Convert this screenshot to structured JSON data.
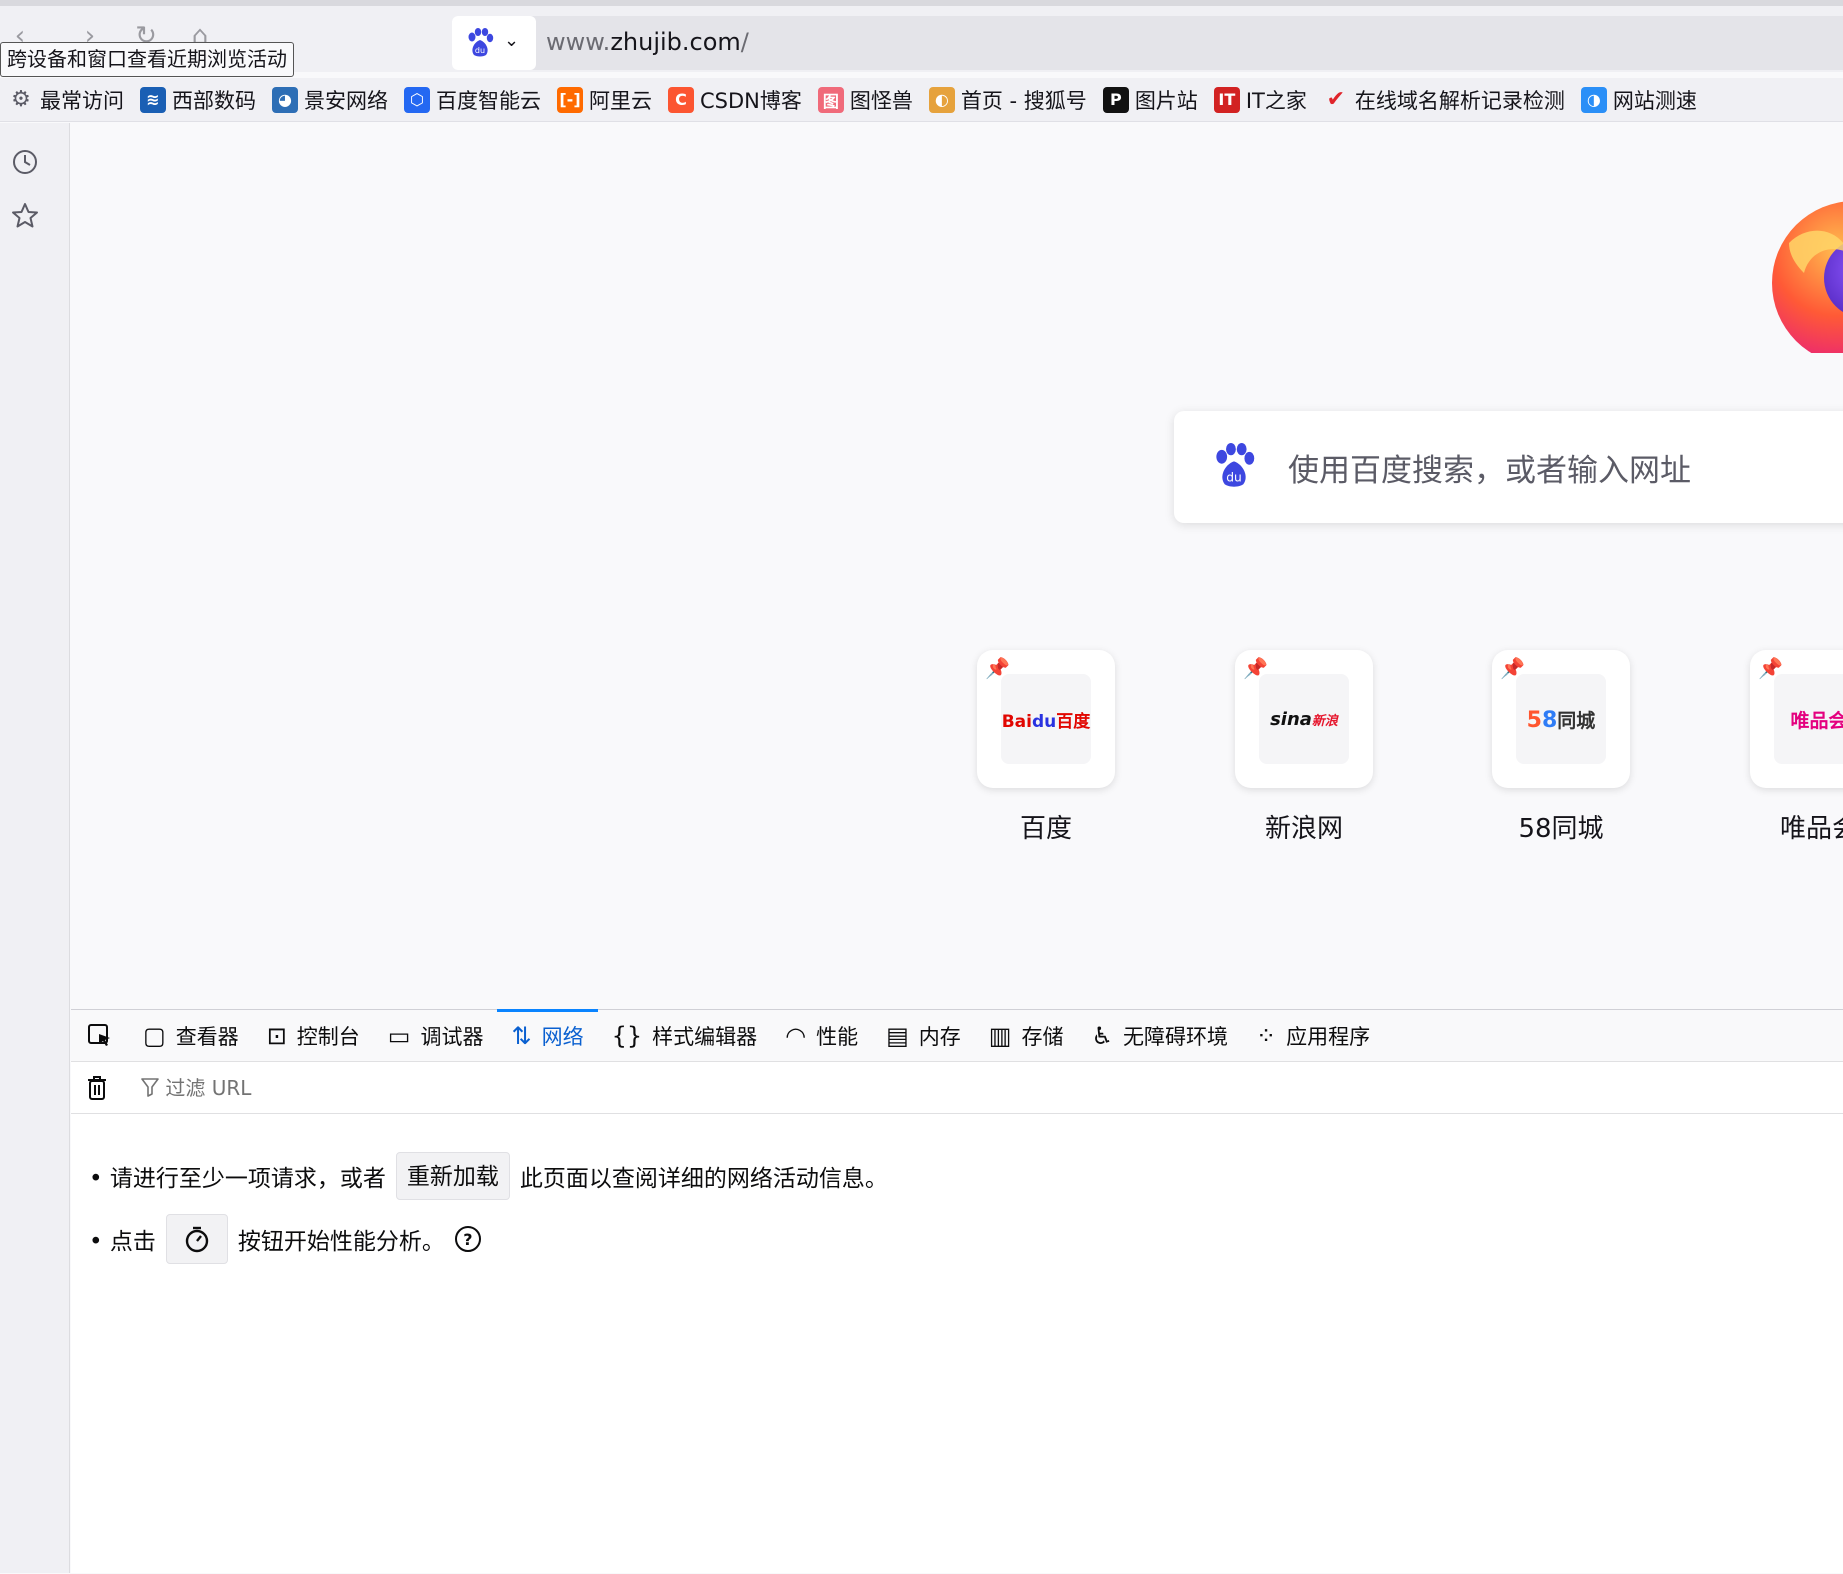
{
  "toolbar": {
    "tooltip": "跨设备和窗口查看近期浏览活动",
    "url_host": "www.zhujib.com",
    "url_path": "/"
  },
  "bookmarks": [
    {
      "label": "最常访问",
      "icon": "gear-icon"
    },
    {
      "label": "西部数码",
      "icon": "west-digital-icon",
      "color": "#1a5fb4"
    },
    {
      "label": "景安网络",
      "icon": "jingan-icon",
      "color": "#2d6eb5"
    },
    {
      "label": "百度智能云",
      "icon": "baidu-cloud-icon",
      "color": "#2468f2"
    },
    {
      "label": "阿里云",
      "icon": "aliyun-icon",
      "color": "#ff6a00"
    },
    {
      "label": "CSDN博客",
      "icon": "csdn-icon",
      "color": "#fc5531"
    },
    {
      "label": "图怪兽",
      "icon": "tuguaishou-icon",
      "color": "#f06a7a"
    },
    {
      "label": "首页 - 搜狐号",
      "icon": "sohu-icon",
      "color": "#e6a23c"
    },
    {
      "label": "图片站",
      "icon": "pic-site-icon",
      "color": "#111111"
    },
    {
      "label": "IT之家",
      "icon": "ithome-icon",
      "color": "#d22222"
    },
    {
      "label": "在线域名解析记录检测",
      "icon": "check-icon",
      "color": "#e0242b"
    },
    {
      "label": "网站测速",
      "icon": "speedtest-icon",
      "color": "#2a8ff7"
    }
  ],
  "sidebar": {
    "history_icon": "history-icon",
    "bookmarks_icon": "star-icon"
  },
  "newtab": {
    "search_placeholder": "使用百度搜索，或者输入网址",
    "tiles": [
      {
        "label": "百度",
        "logo_text": "Bai百度"
      },
      {
        "label": "新浪网",
        "logo_text": "sina新浪"
      },
      {
        "label": "58同城",
        "logo_text": "58同城"
      },
      {
        "label": "唯品会",
        "logo_text": "唯品会"
      }
    ]
  },
  "devtools": {
    "tabs": [
      {
        "label": "查看器",
        "icon": "inspector-icon"
      },
      {
        "label": "控制台",
        "icon": "console-icon"
      },
      {
        "label": "调试器",
        "icon": "debugger-icon"
      },
      {
        "label": "网络",
        "icon": "network-icon",
        "active": true
      },
      {
        "label": "样式编辑器",
        "icon": "style-editor-icon"
      },
      {
        "label": "性能",
        "icon": "performance-icon"
      },
      {
        "label": "内存",
        "icon": "memory-icon"
      },
      {
        "label": "存储",
        "icon": "storage-icon"
      },
      {
        "label": "无障碍环境",
        "icon": "accessibility-icon"
      },
      {
        "label": "应用程序",
        "icon": "application-icon"
      }
    ],
    "filter_placeholder": "过滤 URL",
    "hint1_before": "• 请进行至少一项请求，或者",
    "hint1_button": "重新加载",
    "hint1_after": "此页面以查阅详细的网络活动信息。",
    "hint2_before": "• 点击",
    "hint2_after": "按钮开始性能分析。",
    "accent_color": "#0a84ff"
  }
}
